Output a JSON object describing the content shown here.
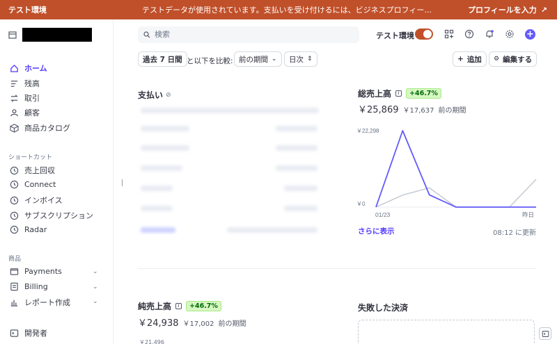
{
  "banner": {
    "mode": "テスト環境",
    "message": "テストデータが使用されています。支払いを受け付けるには、ビジネスプロフィー...",
    "action": "プロフィールを入力"
  },
  "sidebar": {
    "nav": [
      {
        "label": "ホーム",
        "icon": "home-icon"
      },
      {
        "label": "残高",
        "icon": "balance-icon"
      },
      {
        "label": "取引",
        "icon": "transactions-icon"
      },
      {
        "label": "顧客",
        "icon": "customer-icon"
      },
      {
        "label": "商品カタログ",
        "icon": "product-icon"
      }
    ],
    "shortcuts_label": "ショートカット",
    "shortcuts": [
      {
        "label": "売上回収"
      },
      {
        "label": "Connect"
      },
      {
        "label": "インボイス"
      },
      {
        "label": "サブスクリプション"
      },
      {
        "label": "Radar"
      }
    ],
    "products_label": "商品",
    "products": [
      {
        "label": "Payments"
      },
      {
        "label": "Billing"
      },
      {
        "label": "レポート作成"
      }
    ],
    "developers": "開発者"
  },
  "topbar": {
    "search_placeholder": "検索",
    "test_mode_label": "テスト環境"
  },
  "filters": {
    "range": "過去 7 日間",
    "compare_text": "と以下を比較:",
    "compare_value": "前の期間",
    "interval": "日次",
    "add": "追加",
    "edit": "編集する"
  },
  "payments": {
    "title": "支払い"
  },
  "gross_volume": {
    "title": "総売上高",
    "badge": "+46.7%",
    "amount": "￥25,869",
    "previous_amount": "￥17,637",
    "previous_label": "前の期間",
    "more": "さらに表示",
    "updated": "08:12 に更新"
  },
  "chart_data": {
    "type": "line",
    "x": [
      "01/23",
      "",
      "",
      "",
      "",
      "",
      "昨日"
    ],
    "x_tick_labels": [
      "01/23",
      "昨日"
    ],
    "y_tick_labels": [
      "￥22,298",
      "￥0"
    ],
    "ylim": [
      0,
      22298
    ],
    "series": [
      {
        "values": [
          0,
          22298,
          3571,
          0,
          0,
          0,
          0
        ],
        "color": "#625afa"
      },
      {
        "values": [
          0,
          3500,
          5600,
          0,
          0,
          0,
          8100
        ],
        "color": "#c1c7d0"
      }
    ],
    "grid": false,
    "legend": "none"
  },
  "net_volume": {
    "title": "純売上高",
    "badge": "+46.7%",
    "amount": "￥24,938",
    "previous_amount": "￥17,002",
    "previous_label": "前の期間",
    "y_top": "￥21,496"
  },
  "failed_payments": {
    "title": "失敗した決済"
  }
}
